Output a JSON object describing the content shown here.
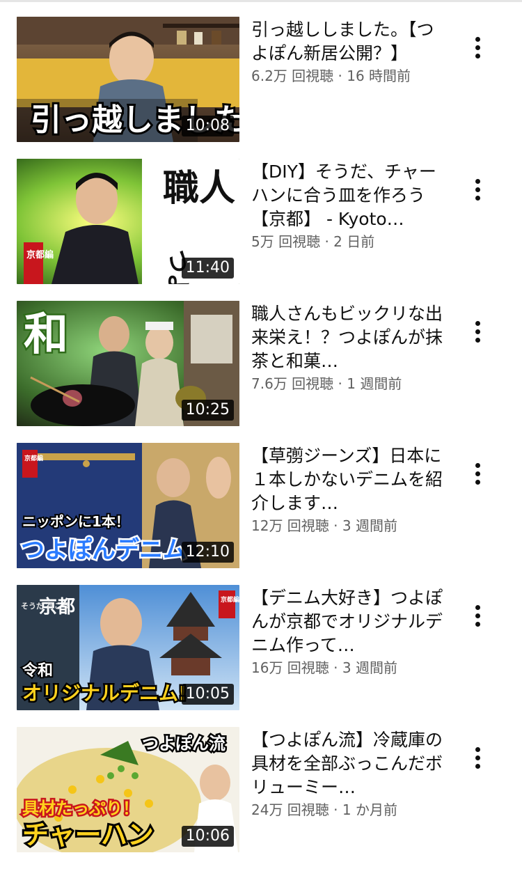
{
  "videos": [
    {
      "title": "引っ越ししました。【つよぽん新居公開？】",
      "stats": "6.2万 回視聴 · 16 時間前",
      "duration": "10:08",
      "thumb_caption": "引っ越しました"
    },
    {
      "title": "【DIY】そうだ、チャーハンに合う皿を作ろう【京都】 - Kyoto…",
      "stats": "5万 回視聴 · 2 日前",
      "duration": "11:40",
      "thumb_caption": "職人",
      "thumb_caption_2": "つよぽん",
      "thumb_badge": "京都編"
    },
    {
      "title": "職人さんもビックリな出来栄え！？つよぽんが抹茶と和菓…",
      "stats": "7.6万 回視聴 · 1 週間前",
      "duration": "10:25",
      "thumb_caption": "和"
    },
    {
      "title": "【草彅ジーンズ】日本に１本しかないデニムを紹介します…",
      "stats": "12万 回視聴 · 3 週間前",
      "duration": "12:10",
      "thumb_caption": "ニッポンに1本！",
      "thumb_caption_2": "つよぽんデニム",
      "thumb_badge": "京都編"
    },
    {
      "title": "【デニム大好き】つよぽんが京都でオリジナルデニム作って…",
      "stats": "16万 回視聴 · 3 週間前",
      "duration": "10:05",
      "thumb_caption": "京都",
      "thumb_caption_2": "令和",
      "thumb_caption_3": "オリジナルデニム!",
      "thumb_caption_4": "そうだ 行こう",
      "thumb_badge": "京都編"
    },
    {
      "title": "【つよぽん流】冷蔵庫の具材を全部ぶっこんだボリューミー…",
      "stats": "24万 回視聴 · 1 か月前",
      "duration": "10:06",
      "thumb_caption": "つよぽん流",
      "thumb_caption_2": "具材たっぷり！",
      "thumb_caption_3": "チャーハン"
    }
  ],
  "colors": {
    "text_primary": "#0f0f0f",
    "text_secondary": "#606060",
    "duration_bg": "#000000cc",
    "divider": "#e5e5e5"
  },
  "icons": {
    "menu": "more-vert-icon"
  }
}
